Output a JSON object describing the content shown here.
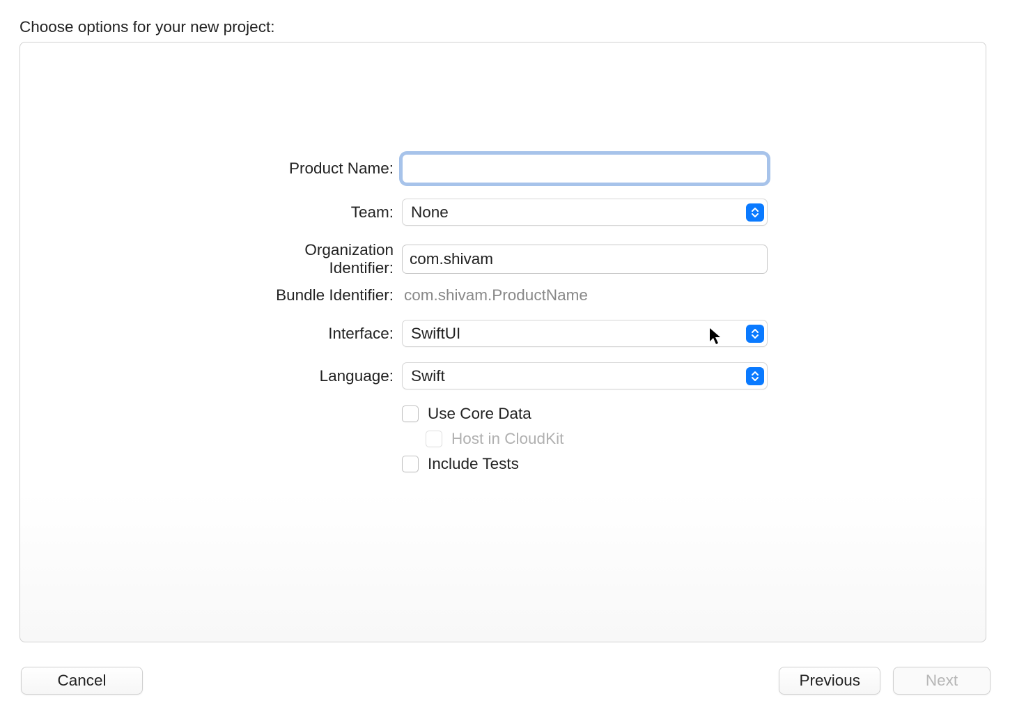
{
  "title": "Choose options for your new project:",
  "fields": {
    "productName": {
      "label": "Product Name:",
      "value": ""
    },
    "team": {
      "label": "Team:",
      "value": "None"
    },
    "orgIdentifier": {
      "label": "Organization Identifier:",
      "value": "com.shivam"
    },
    "bundleIdentifier": {
      "label": "Bundle Identifier:",
      "value": "com.shivam.ProductName"
    },
    "interface": {
      "label": "Interface:",
      "value": "SwiftUI"
    },
    "language": {
      "label": "Language:",
      "value": "Swift"
    }
  },
  "checks": {
    "useCoreData": {
      "label": "Use Core Data",
      "checked": false
    },
    "hostCloudKit": {
      "label": "Host in CloudKit",
      "checked": false,
      "disabled": true
    },
    "includeTests": {
      "label": "Include Tests",
      "checked": false
    }
  },
  "buttons": {
    "cancel": "Cancel",
    "previous": "Previous",
    "next": "Next"
  }
}
